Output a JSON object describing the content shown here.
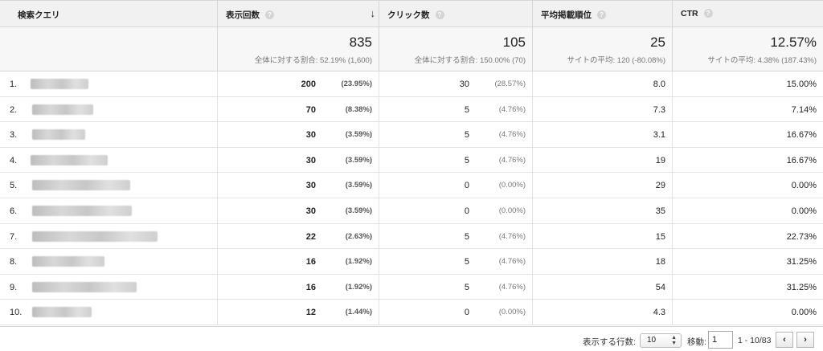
{
  "header": {
    "query": "検索クエリ",
    "impressions": "表示回数",
    "clicks": "クリック数",
    "avg_position": "平均掲載順位",
    "ctr": "CTR",
    "help_glyph": "?",
    "sort_glyph": "↓"
  },
  "totals": {
    "impressions": "835",
    "impressions_sub": "全体に対する割合: 52.19% (1,600)",
    "clicks": "105",
    "clicks_sub": "全体に対する割合: 150.00% (70)",
    "avg_position": "25",
    "avg_position_sub": "サイトの平均: 120 (-80.08%)",
    "ctr": "12.57%",
    "ctr_sub": "サイトの平均: 4.38% (187.43%)"
  },
  "rows": [
    {
      "num": "1.",
      "imp": "200",
      "imp_pct": "(23.95%)",
      "clk": "30",
      "clk_pct": "(28.57%)",
      "pos": "8.0",
      "ctr": "15.00%"
    },
    {
      "num": "2.",
      "imp": "70",
      "imp_pct": "(8.38%)",
      "clk": "5",
      "clk_pct": "(4.76%)",
      "pos": "7.3",
      "ctr": "7.14%"
    },
    {
      "num": "3.",
      "imp": "30",
      "imp_pct": "(3.59%)",
      "clk": "5",
      "clk_pct": "(4.76%)",
      "pos": "3.1",
      "ctr": "16.67%"
    },
    {
      "num": "4.",
      "imp": "30",
      "imp_pct": "(3.59%)",
      "clk": "5",
      "clk_pct": "(4.76%)",
      "pos": "19",
      "ctr": "16.67%"
    },
    {
      "num": "5.",
      "imp": "30",
      "imp_pct": "(3.59%)",
      "clk": "0",
      "clk_pct": "(0.00%)",
      "pos": "29",
      "ctr": "0.00%"
    },
    {
      "num": "6.",
      "imp": "30",
      "imp_pct": "(3.59%)",
      "clk": "0",
      "clk_pct": "(0.00%)",
      "pos": "35",
      "ctr": "0.00%"
    },
    {
      "num": "7.",
      "imp": "22",
      "imp_pct": "(2.63%)",
      "clk": "5",
      "clk_pct": "(4.76%)",
      "pos": "15",
      "ctr": "22.73%"
    },
    {
      "num": "8.",
      "imp": "16",
      "imp_pct": "(1.92%)",
      "clk": "5",
      "clk_pct": "(4.76%)",
      "pos": "18",
      "ctr": "31.25%"
    },
    {
      "num": "9.",
      "imp": "16",
      "imp_pct": "(1.92%)",
      "clk": "5",
      "clk_pct": "(4.76%)",
      "pos": "54",
      "ctr": "31.25%"
    },
    {
      "num": "10.",
      "imp": "12",
      "imp_pct": "(1.44%)",
      "clk": "0",
      "clk_pct": "(0.00%)",
      "pos": "4.3",
      "ctr": "0.00%"
    }
  ],
  "footer": {
    "rows_label": "表示する行数:",
    "rows_value": "10",
    "goto_label": "移動:",
    "goto_value": "1",
    "range": "1 - 10/83",
    "prev_glyph": "‹",
    "next_glyph": "›"
  }
}
